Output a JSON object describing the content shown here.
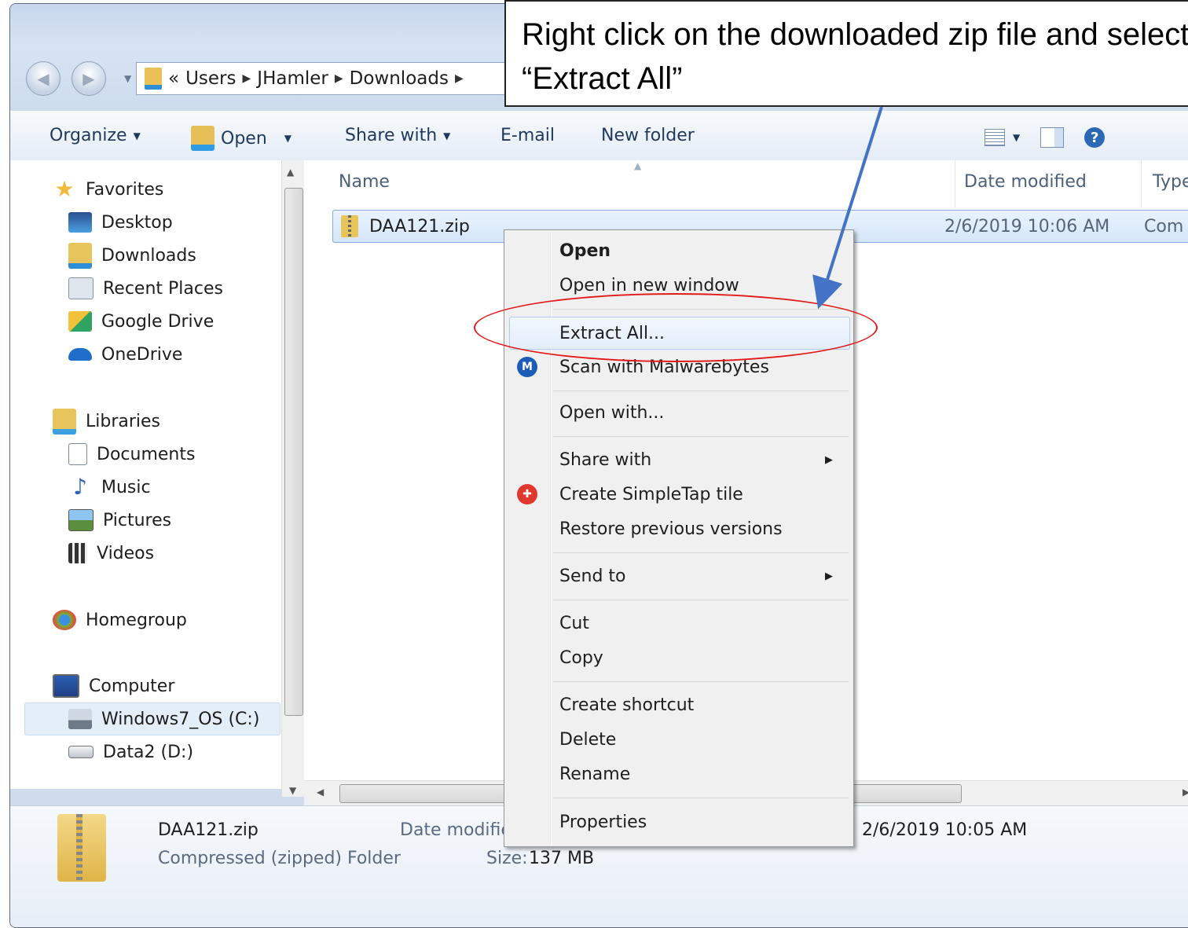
{
  "callout": {
    "text": "Right click on the downloaded zip file and select “Extract All”"
  },
  "address": {
    "overflow": "«",
    "segments": [
      "Users",
      "JHamler",
      "Downloads"
    ]
  },
  "toolbar": {
    "organize": "Organize",
    "open": "Open",
    "share_with": "Share with",
    "email": "E-mail",
    "new_folder": "New folder"
  },
  "nav": {
    "favorites": "Favorites",
    "desktop": "Desktop",
    "downloads": "Downloads",
    "recent_places": "Recent Places",
    "google_drive": "Google Drive",
    "onedrive": "OneDrive",
    "libraries": "Libraries",
    "documents": "Documents",
    "music": "Music",
    "pictures": "Pictures",
    "videos": "Videos",
    "homegroup": "Homegroup",
    "computer": "Computer",
    "windows7_os": "Windows7_OS (C:)",
    "data2": "Data2 (D:)"
  },
  "columns": {
    "name": "Name",
    "date_modified": "Date modified",
    "type": "Type"
  },
  "file": {
    "name": "DAA121.zip",
    "date_modified": "2/6/2019 10:06 AM",
    "type": "Com"
  },
  "context_menu": {
    "open": "Open",
    "open_new_window": "Open in new window",
    "extract_all": "Extract All...",
    "scan_malwarebytes": "Scan with Malwarebytes",
    "open_with": "Open with...",
    "share_with": "Share with",
    "create_simpletap": "Create SimpleTap tile",
    "restore_previous": "Restore previous versions",
    "send_to": "Send to",
    "cut": "Cut",
    "copy": "Copy",
    "create_shortcut": "Create shortcut",
    "delete": "Delete",
    "rename": "Rename",
    "properties": "Properties"
  },
  "details": {
    "name": "DAA121.zip",
    "type": "Compressed (zipped) Folder",
    "date_modified_label": "Date modifie",
    "size_label": "Size:",
    "size_value": "137 MB",
    "date_value": "2/6/2019 10:05 AM"
  },
  "colors": {
    "accent": "#2d68b5",
    "annotation_red": "#e31a1a",
    "arrow_blue": "#4472c4"
  }
}
